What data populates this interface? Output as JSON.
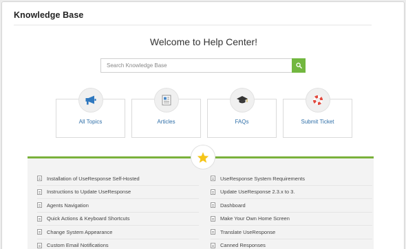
{
  "header": {
    "title": "Knowledge Base"
  },
  "hero": {
    "welcome": "Welcome to Help Center!",
    "search_placeholder": "Search Knowledge Base",
    "search_icon": "search-icon"
  },
  "tiles": [
    {
      "label": "All Topics",
      "icon": "megaphone-icon"
    },
    {
      "label": "Articles",
      "icon": "document-icon"
    },
    {
      "label": "FAQs",
      "icon": "graduation-cap-icon"
    },
    {
      "label": "Submit Ticket",
      "icon": "lifebuoy-icon"
    }
  ],
  "featured": {
    "icon": "star-icon",
    "left": [
      "Installation of UseResponse Self-Hosted",
      "Instructions to Update UseResponse",
      "Agents Navigation",
      "Quick Actions & Keyboard Shortcuts",
      "Change System Appearance",
      "Custom Email Notifications"
    ],
    "right": [
      "UseResponse System Requirements",
      "Update UseResponse 2.3.x to 3.",
      "Dashboard",
      "Make Your Own Home Screen",
      "Translate UseResponse",
      "Canned Responses"
    ]
  },
  "colors": {
    "accent_green": "#72b73f",
    "link_blue": "#2f6fa8",
    "star_yellow": "#f5c518",
    "lifebuoy_red": "#e2483d"
  }
}
